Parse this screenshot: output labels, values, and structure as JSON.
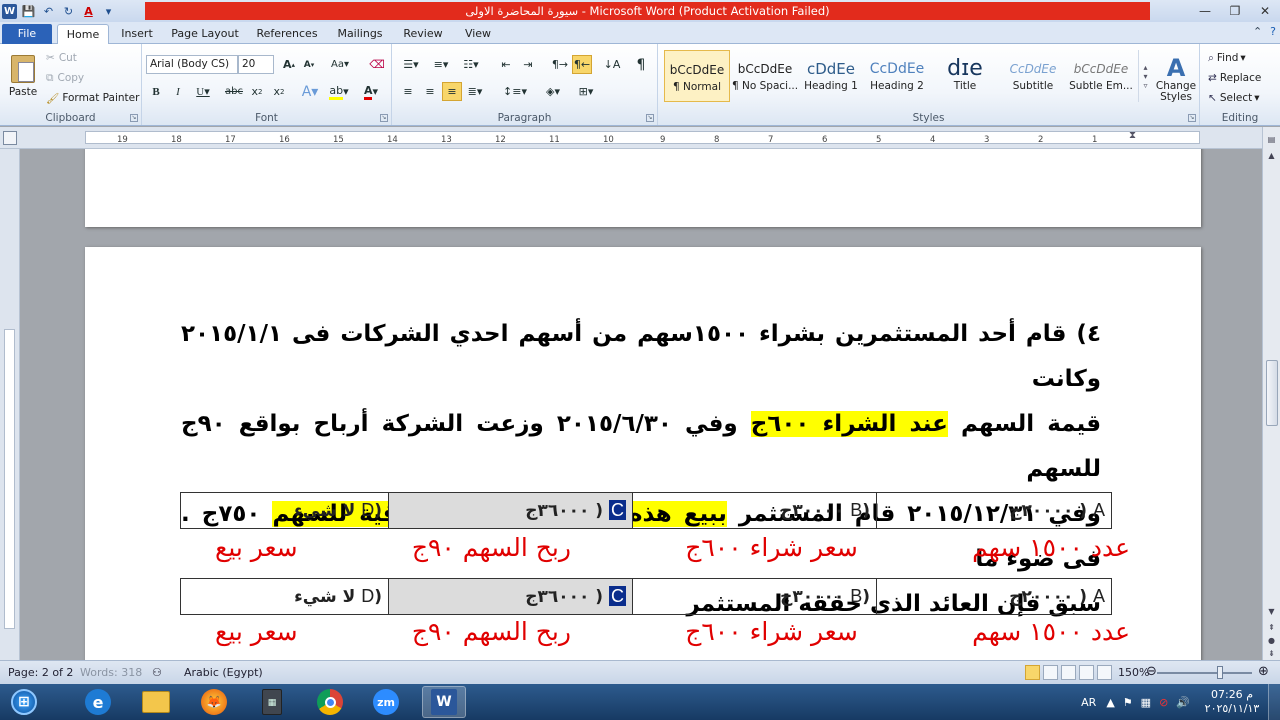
{
  "window": {
    "title": "سيورة المحاضرة الاولى  -  Microsoft Word (Product Activation Failed)",
    "minimize": "—",
    "restore": "❐",
    "close": "✕"
  },
  "tabs": [
    "File",
    "Home",
    "Insert",
    "Page Layout",
    "References",
    "Mailings",
    "Review",
    "View"
  ],
  "clipboard": {
    "paste": "Paste",
    "cut": "Cut",
    "copy": "Copy",
    "format_painter": "Format Painter",
    "label": "Clipboard"
  },
  "font": {
    "name": "Arial (Body CS)",
    "size": "20",
    "label": "Font"
  },
  "paragraph": {
    "label": "Paragraph"
  },
  "styles": {
    "label": "Styles",
    "items": [
      {
        "preview": "bCcDdEe",
        "name": "¶ Normal"
      },
      {
        "preview": "bCcDdEe",
        "name": "¶ No Spaci..."
      },
      {
        "preview": "cDdEe",
        "name": "Heading 1"
      },
      {
        "preview": "CcDdEe",
        "name": "Heading 2"
      },
      {
        "preview": "dɪe",
        "name": "Title"
      },
      {
        "preview": "CcDdEe",
        "name": "Subtitle"
      },
      {
        "preview": "bCcDdEe",
        "name": "Subtle Em..."
      }
    ],
    "change": "Change Styles"
  },
  "editing": {
    "find": "Find",
    "replace": "Replace",
    "select": "Select",
    "label": "Editing"
  },
  "ruler": {
    "ticks": [
      "19",
      "18",
      "17",
      "16",
      "15",
      "14",
      "13",
      "12",
      "11",
      "10",
      "9",
      "8",
      "7",
      "6",
      "5",
      "4",
      "3",
      "2",
      "1"
    ]
  },
  "document": {
    "line1": "٤) قام أحد المستثمرين بشراء ١٥٠٠سهم من أسهم احدي الشركات فى ٢٠١٥/١/١ وكانت",
    "line2_pre": "قيمة السهم ",
    "line2_hl": "عند الشراء ٦٠٠ج",
    "line2_post": "  وفي ٢٠١٥/٦/٣٠ وزعت الشركة أرباح بواقع ٩٠ج للسهم",
    "line3_pre": "وفي ٢٠١٥/١٢/٣١ قام المستثمر ",
    "line3_hl": "ببيع هذه وكانت القيمة السوقية للسهم",
    "line3_post": " ٧٥٠ج . فى ضوء ما",
    "line4": "سبق فإن العائد الذى حققه المستثمر",
    "answers": [
      {
        "letter": "A",
        "text": "٢٠٠٠٠ج"
      },
      {
        "letter": "B",
        "text": "٣٠٠٠٠ج"
      },
      {
        "letter": "C",
        "text": "٣٦٠٠٠ج"
      },
      {
        "letter": "D",
        "text": "لا شيء"
      }
    ],
    "notes": [
      "عدد ١٥٠٠ سهم",
      "سعر شراء ٦٠٠ج",
      "ربح السهم ٩٠ج",
      "سعر بيع"
    ]
  },
  "status": {
    "page": "Page: 2 of 2",
    "words": "Words: 318",
    "language": "Arabic (Egypt)",
    "zoom": "150%"
  },
  "taskbar": {
    "lang": "AR",
    "time": "07:26 م",
    "date": "٢٠٢٥/١١/١٣"
  }
}
